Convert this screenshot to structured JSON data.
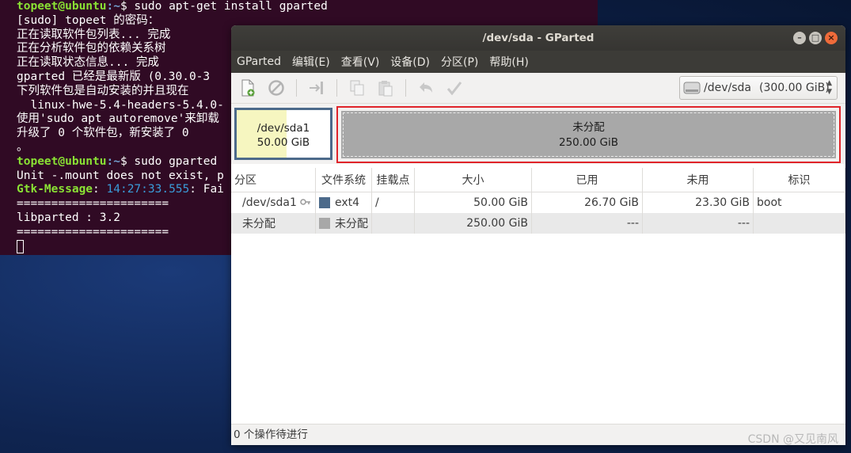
{
  "terminal": {
    "lines": [
      {
        "user": "topeet@ubuntu",
        "path": ":~",
        "cmd": "$ sudo apt-get install gparted"
      },
      {
        "text": "[sudo] topeet 的密码："
      },
      {
        "text": "正在读取软件包列表... 完成"
      },
      {
        "text": "正在分析软件包的依赖关系树"
      },
      {
        "text": "正在读取状态信息... 完成"
      },
      {
        "text": "gparted 已经是最新版 (0.30.0-3"
      },
      {
        "text": "下列软件包是自动安装的并且现在"
      },
      {
        "text": "  linux-hwe-5.4-headers-5.4.0-"
      },
      {
        "text": "使用'sudo apt autoremove'来卸载"
      },
      {
        "text": "升级了 0 个软件包，新安装了 0 "
      },
      {
        "text": "。"
      },
      {
        "user": "topeet@ubuntu",
        "path": ":~",
        "cmd": "$ sudo gparted"
      },
      {
        "text": "Unit -.mount does not exist, p"
      },
      {
        "msg_key": "Gtk-Message",
        "msg_sep": ": ",
        "time": "14:27:33.555",
        "rest": ": Fai"
      },
      {
        "text": "======================"
      },
      {
        "text": "libparted : 3.2"
      },
      {
        "text": "======================"
      }
    ]
  },
  "window": {
    "title": "/dev/sda - GParted",
    "menu": [
      "GParted",
      "编辑(E)",
      "查看(V)",
      "设备(D)",
      "分区(P)",
      "帮助(H)"
    ],
    "toolbar_icons": [
      "new-partition-icon",
      "delete-icon",
      "resize-move-icon",
      "copy-icon",
      "paste-icon",
      "undo-icon",
      "apply-icon"
    ],
    "device_selector": {
      "device": "/dev/sda",
      "size": "(300.00 GiB)"
    },
    "diskmap": {
      "partition": {
        "name": "/dev/sda1",
        "size": "50.00 GiB",
        "used_fraction": 0.53
      },
      "unallocated": {
        "name": "未分配",
        "size": "250.00 GiB"
      }
    },
    "table": {
      "headers": [
        "分区",
        "文件系统",
        "挂载点",
        "大小",
        "已用",
        "未用",
        "标识"
      ],
      "rows": [
        {
          "partition": "/dev/sda1",
          "fs": "ext4",
          "fs_color": "#4c6a8a",
          "mount": "/",
          "size": "50.00 GiB",
          "used": "26.70 GiB",
          "unused": "23.30 GiB",
          "flags": "boot"
        },
        {
          "partition": "未分配",
          "fs": "未分配",
          "fs_color": "#a8a8a8",
          "mount": "",
          "size": "250.00 GiB",
          "used": "---",
          "unused": "---",
          "flags": ""
        }
      ]
    },
    "status": "0 个操作待进行"
  },
  "watermark": "CSDN @又见南风"
}
